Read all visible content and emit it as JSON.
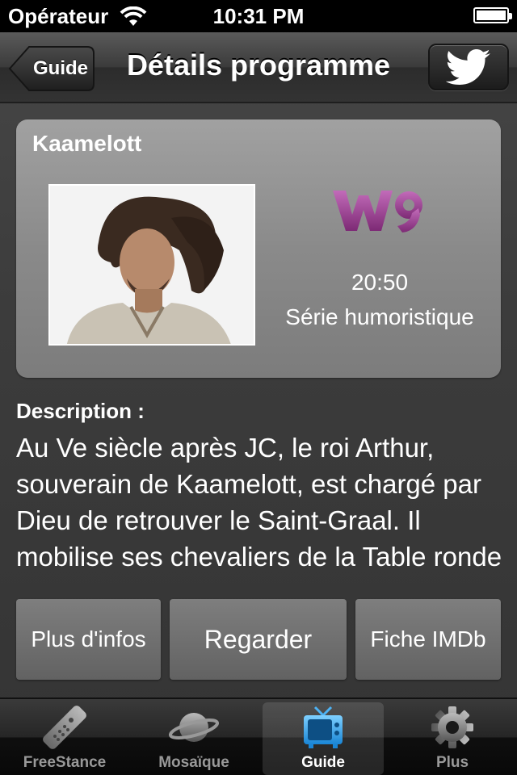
{
  "status_bar": {
    "carrier": "Opérateur",
    "time": "10:31 PM",
    "battery_level": 1.0
  },
  "nav": {
    "back_label": "Guide",
    "title": "Détails programme",
    "share_icon": "twitter-icon"
  },
  "program": {
    "name": "Kaamelott",
    "channel_logo_text": "W9",
    "time": "20:50",
    "genre": "Série humoristique",
    "brand_color": "#a03c95"
  },
  "description": {
    "label": "Description :",
    "text": "Au Ve siècle après JC, le roi Arthur, souverain de Kaamelott, est chargé par Dieu de retrouver le Saint-Graal. Il mobilise ses chevaliers de la Table ronde"
  },
  "actions": {
    "more_info": "Plus d'infos",
    "watch": "Regarder",
    "imdb": "Fiche IMDb"
  },
  "tabs": [
    {
      "label": "FreeStance",
      "icon": "remote-control-icon",
      "active": false
    },
    {
      "label": "Mosaïque",
      "icon": "planet-icon",
      "active": false
    },
    {
      "label": "Guide",
      "icon": "tv-icon",
      "active": true
    },
    {
      "label": "Plus",
      "icon": "gear-icon",
      "active": false
    }
  ]
}
